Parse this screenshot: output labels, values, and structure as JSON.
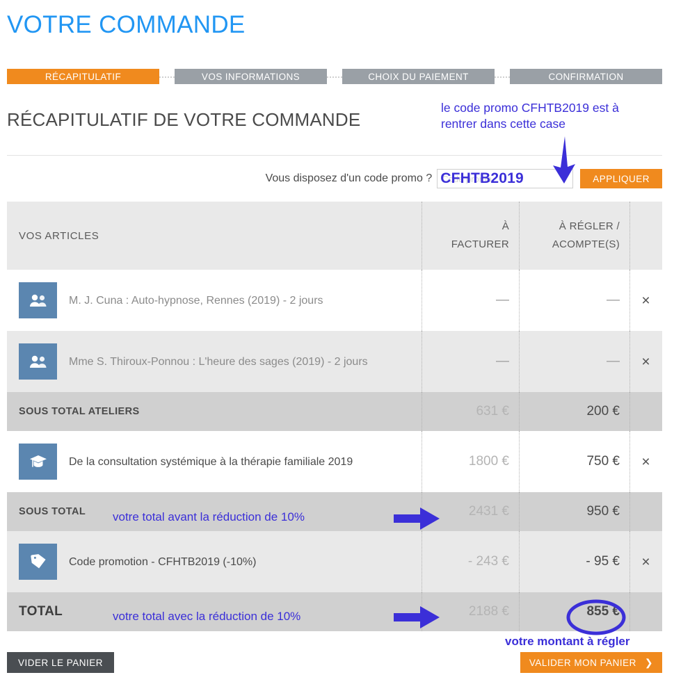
{
  "page": {
    "title": "VOTRE COMMANDE",
    "section_title": "RÉCAPITULATIF DE VOTRE COMMANDE",
    "accent_orange": "#f08a1e",
    "title_blue": "#2196f3",
    "annotation_blue": "#3b2fd8"
  },
  "steps": [
    {
      "label": "RÉCAPITULATIF",
      "active": true
    },
    {
      "label": "VOS INFORMATIONS",
      "active": false
    },
    {
      "label": "CHOIX DU PAIEMENT",
      "active": false
    },
    {
      "label": "CONFIRMATION",
      "active": false
    }
  ],
  "promo": {
    "label": "Vous disposez d'un code promo ?",
    "placeholder": "Code promo",
    "value": "",
    "overlay_code": "CFHTB2019",
    "apply_label": "APPLIQUER"
  },
  "table": {
    "headers": {
      "articles": "VOS ARTICLES",
      "facturer_line1": "À",
      "facturer_line2": "FACTURER",
      "regler_line1": "À RÉGLER /",
      "regler_line2": "ACOMPTE(S)"
    },
    "rows": [
      {
        "type": "item",
        "icon": "people-icon",
        "label": "M. J. Cuna : Auto-hypnose, Rennes (2019) - 2 jours",
        "a_facturer": "—",
        "a_regler": "—",
        "delete": "×"
      },
      {
        "type": "item",
        "icon": "people-icon",
        "label": "Mme S. Thiroux-Ponnou : L'heure des sages (2019) - 2 jours",
        "a_facturer": "—",
        "a_regler": "—",
        "delete": "×"
      },
      {
        "type": "subtotal",
        "label": "SOUS TOTAL ATELIERS",
        "a_facturer": "631 €",
        "a_regler": "200 €"
      },
      {
        "type": "item",
        "icon": "graduation-cap-icon",
        "label": "De la consultation systémique à la thérapie familiale 2019",
        "a_facturer": "1800 €",
        "a_regler": "750 €",
        "delete": "×"
      },
      {
        "type": "subtotal",
        "label": "SOUS TOTAL",
        "a_facturer": "2431 €",
        "a_regler": "950 €"
      },
      {
        "type": "item",
        "icon": "price-tag-icon",
        "label": "Code promotion - CFHTB2019 (-10%)",
        "a_facturer": "- 243 €",
        "a_regler": "- 95 €",
        "delete": "×"
      },
      {
        "type": "total",
        "label": "TOTAL",
        "a_facturer": "2188 €",
        "a_regler": "855 €"
      }
    ]
  },
  "footer": {
    "empty_cart_label": "VIDER LE PANIER",
    "validate_label": "VALIDER MON PANIER",
    "validate_chevron": "❯"
  },
  "annotations": {
    "promo_line1": "le code promo CFHTB2019 est à",
    "promo_line2": "rentrer dans cette case",
    "subtotal_note": "votre total avant la réduction de 10%",
    "total_note": "votre total avec la réduction de 10%",
    "amount_note": "votre montant à régler"
  }
}
